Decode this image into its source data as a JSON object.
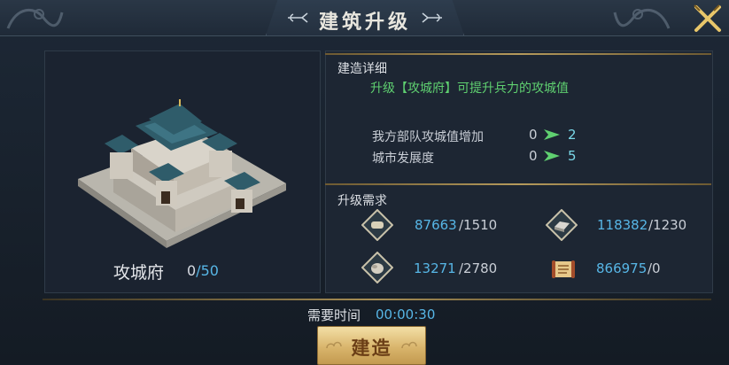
{
  "title": "建筑升级",
  "building": {
    "name": "攻城府",
    "level_current": "0",
    "level_max": "/50"
  },
  "details": {
    "section_title": "建造详细",
    "description": "升级【攻城府】可提升兵力的攻城值",
    "stats": [
      {
        "label": "我方部队攻城值增加",
        "from": "0",
        "to": "2"
      },
      {
        "label": "城市发展度",
        "from": "0",
        "to": "5"
      }
    ]
  },
  "requirements": {
    "section_title": "升级需求",
    "resources": [
      {
        "icon": "scroll-icon",
        "have": "87663",
        "need": "/1510"
      },
      {
        "icon": "iron-ingot-icon",
        "have": "118382",
        "need": "/1230"
      },
      {
        "icon": "stone-icon",
        "have": "13271",
        "need": "/2780"
      },
      {
        "icon": "edict-scroll-icon",
        "have": "866975",
        "need": "/0"
      }
    ]
  },
  "time": {
    "label": "需要时间",
    "value": "00:00:30"
  },
  "build_button": "建造",
  "colors": {
    "accent_blue": "#57b6e6",
    "green_text": "#5fd070",
    "gold": "#b59a5c"
  }
}
